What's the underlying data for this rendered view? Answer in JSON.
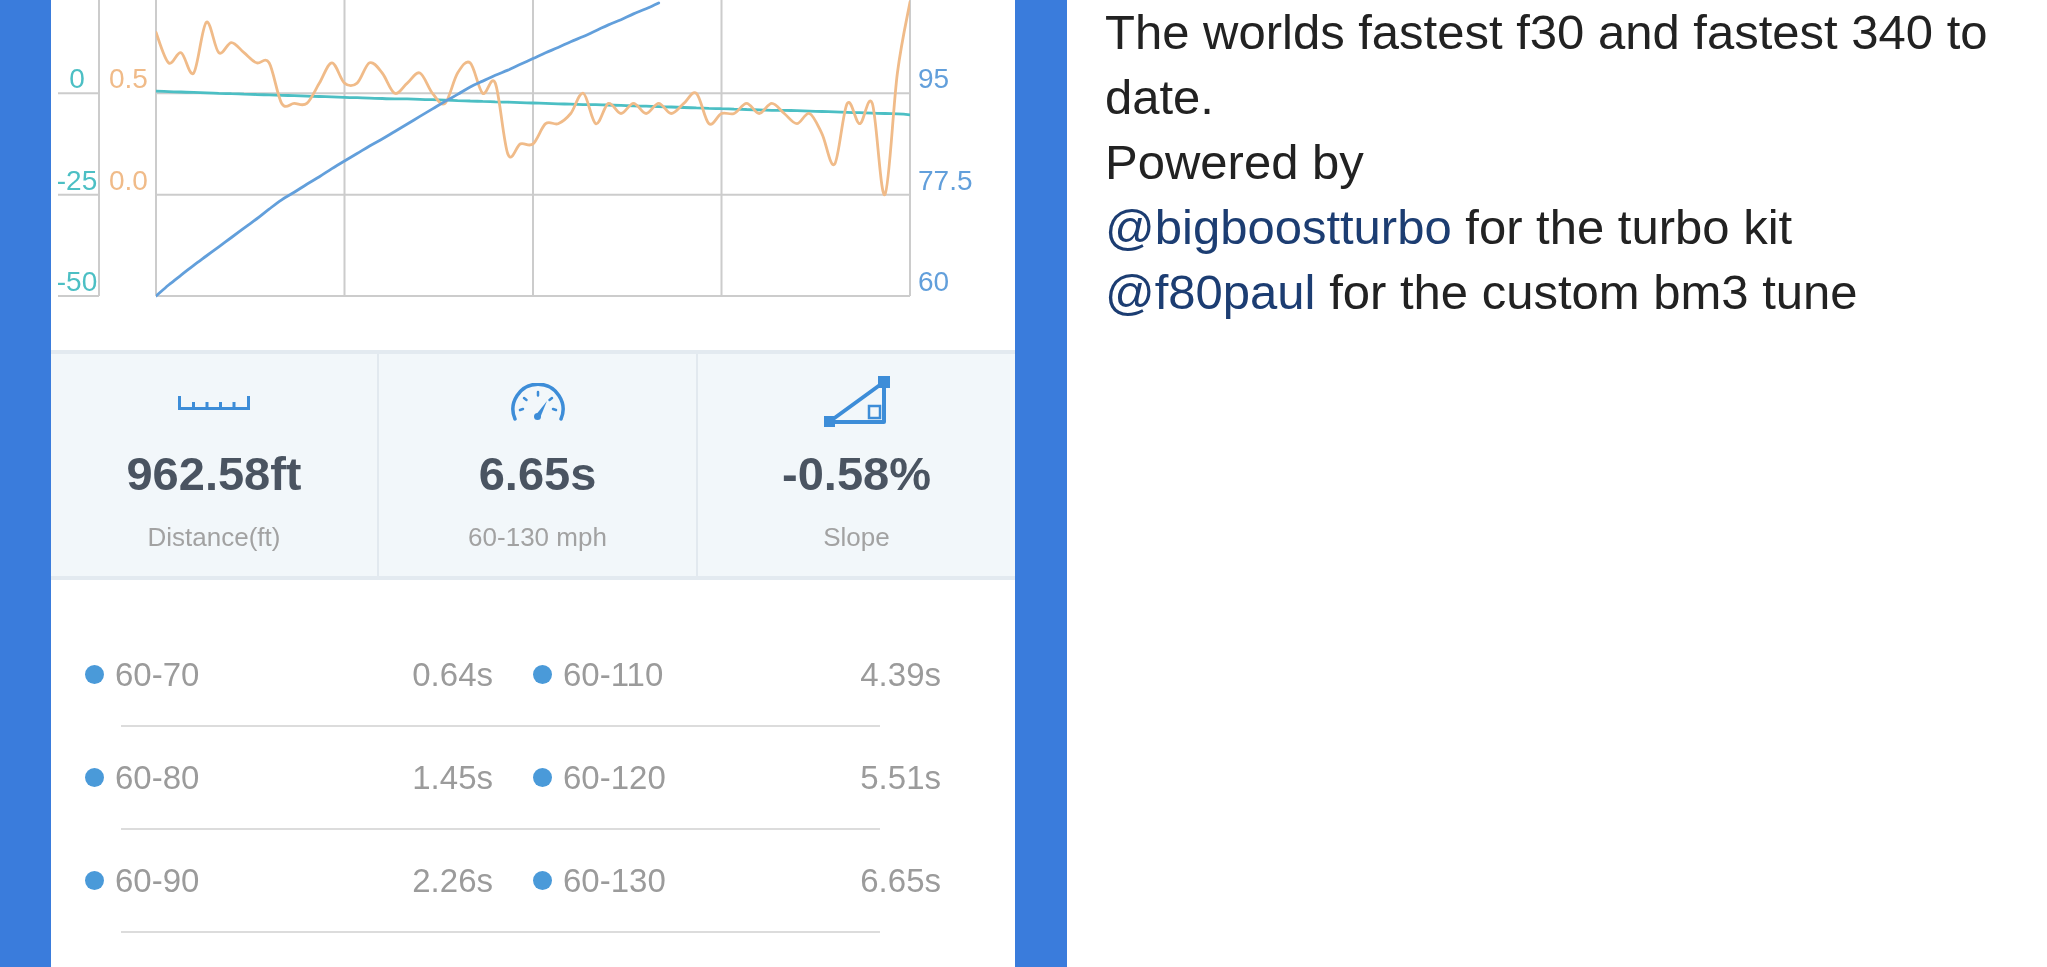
{
  "chart": {
    "chart_data": {
      "type": "line",
      "grid": true,
      "ylim": [
        -50,
        23
      ],
      "yticks": [
        {
          "value": 0,
          "label": "0"
        },
        {
          "value": -25,
          "label": "-25"
        },
        {
          "value": -50,
          "label": "-50"
        }
      ],
      "y2lim": [
        -0.5,
        0.96
      ],
      "y2ticks": [
        {
          "value": 0.5,
          "label": "0.5"
        },
        {
          "value": 0,
          "label": "0.0"
        }
      ],
      "y3lim": [
        60,
        111.1
      ],
      "y3ticks": [
        {
          "value": 95,
          "label": "95"
        },
        {
          "value": 77.5,
          "label": "77.5"
        },
        {
          "value": 60,
          "label": "60"
        }
      ],
      "series": [
        {
          "color": "#4cbfc4",
          "values": [
            0.5,
            0.4,
            0.3,
            0.2,
            0.1,
            0.0,
            -0.1,
            -0.2,
            -0.3,
            -0.4,
            -0.5,
            -0.6,
            -0.7,
            -0.8,
            -0.9,
            -1.0,
            -1.1,
            -1.2,
            -1.3,
            -1.4,
            -1.4,
            -1.5,
            -1.6,
            -1.7,
            -1.8,
            -1.9,
            -2.0,
            -2.1,
            -2.2,
            -2.3,
            -2.4,
            -2.5,
            -2.6,
            -2.7,
            -2.8,
            -2.8,
            -2.9,
            -3.0,
            -3.1,
            -3.2,
            -3.3,
            -3.4,
            -3.5,
            -3.6,
            -3.7,
            -3.8,
            -3.9,
            -4.0,
            -4.1,
            -4.2,
            -4.2,
            -4.3,
            -4.4,
            -4.5,
            -4.6,
            -4.7,
            -4.8,
            -4.9,
            -5.0,
            -5.1,
            -5.3
          ]
        },
        {
          "color": "#f0bb89",
          "axis": "y2",
          "values": [
            0.8,
            0.65,
            0.7,
            0.6,
            0.85,
            0.7,
            0.75,
            0.7,
            0.65,
            0.65,
            0.45,
            0.45,
            0.45,
            0.55,
            0.65,
            0.55,
            0.55,
            0.65,
            0.6,
            0.5,
            0.55,
            0.6,
            0.5,
            0.45,
            0.6,
            0.65,
            0.5,
            0.55,
            0.2,
            0.25,
            0.25,
            0.35,
            0.35,
            0.4,
            0.5,
            0.35,
            0.45,
            0.4,
            0.45,
            0.4,
            0.45,
            0.4,
            0.45,
            0.5,
            0.35,
            0.4,
            0.4,
            0.45,
            0.4,
            0.45,
            0.4,
            0.35,
            0.4,
            0.3,
            0.15,
            0.45,
            0.35,
            0.45,
            0,
            0.6,
            0.95
          ]
        },
        {
          "color": "#629fdb",
          "axis": "y3",
          "values": [
            60.0,
            61.9,
            63.6,
            65.3,
            66.9,
            68.5,
            70.1,
            71.7,
            73.3,
            75.0,
            76.6,
            77.9,
            79.3,
            80.6,
            82.0,
            83.3,
            84.6,
            85.9,
            87.1,
            88.4,
            89.7,
            91.0,
            92.3,
            93.6,
            94.8,
            96.1,
            97.1,
            98.1,
            99.0,
            100.0,
            101.0,
            102.0,
            102.9,
            103.9,
            104.8,
            105.8,
            106.8,
            107.7,
            108.7,
            109.6,
            110.6,
            null,
            null,
            null,
            null,
            null,
            null,
            null,
            null,
            null,
            null,
            null,
            null,
            null,
            null,
            null,
            null,
            null,
            null,
            null,
            null
          ]
        }
      ]
    }
  },
  "stats": [
    {
      "kind": "distance",
      "value": "962.58ft",
      "label": "Distance(ft)"
    },
    {
      "kind": "time",
      "value": "6.65s",
      "label": "60-130 mph"
    },
    {
      "kind": "slope",
      "value": "-0.58%",
      "label": "Slope"
    }
  ],
  "splits": {
    "rows": [
      [
        {
          "range": "60-70",
          "time": "0.64s"
        },
        {
          "range": "60-110",
          "time": "4.39s"
        }
      ],
      [
        {
          "range": "60-80",
          "time": "1.45s"
        },
        {
          "range": "60-120",
          "time": "5.51s"
        }
      ],
      [
        {
          "range": "60-90",
          "time": "2.26s"
        },
        {
          "range": "60-130",
          "time": "6.65s"
        }
      ]
    ]
  },
  "caption": [
    {
      "text": "The worlds fastest f30 and fastest 340 to date."
    },
    {
      "text": "Powered by"
    },
    {
      "mention": "@bigboostturbo",
      "text": "for the turbo kit"
    },
    {
      "mention": "@f80paul",
      "text": "for the custom bm3 tune"
    }
  ]
}
